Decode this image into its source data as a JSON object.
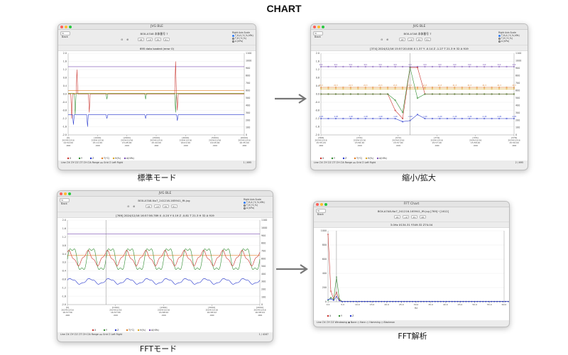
{
  "page_title": "CHART",
  "windows": [
    {
      "id": "w1",
      "window_title": "JVG BLE",
      "back_label": "< Back",
      "file_name": "BOX-A7A8 本体番号 7",
      "info_line": "695 data loaded (error 0)",
      "caption": "標準モード",
      "right_axis_scale": {
        "title": "Right Axis Scale",
        "options": [
          "T,H,A (℃,%,hPa)",
          "T,H (℃,%)",
          "A (hPa)"
        ],
        "selected": 0
      },
      "y_left": [
        "2.0",
        "1.6",
        "1.2",
        "0.8",
        "0.4",
        "0.0",
        "-0.4",
        "-0.8",
        "-1.2",
        "-1.6",
        "-2.0"
      ],
      "y_right": [
        "1100",
        "1000",
        "900",
        "800",
        "700",
        "600",
        "500",
        "400",
        "300",
        "200",
        "100",
        "0"
      ],
      "x_ticks": [
        [
          "[0]",
          "2024/12/16",
          "14:54:00",
          ".000"
        ],
        [
          "[1000]",
          "2024/12/16",
          "15:11:00",
          ".000"
        ],
        [
          "[2000]",
          "2024/12/16",
          "15:28:00",
          ".000"
        ],
        [
          "[3000]",
          "2024/12/16",
          "15:44:00",
          ".000"
        ],
        [
          "[4000]",
          "2024/12/16",
          "16:01:00",
          ".000"
        ],
        [
          "[5000]",
          "2024/12/16",
          "16:18:00",
          ".000"
        ],
        [
          "[6000]",
          "2024/12/16",
          "16:35:00",
          ".000"
        ]
      ],
      "legend": [
        "X",
        "Y",
        "Z",
        "T(℃)",
        "H(%)",
        "A(hPa)"
      ],
      "bottom_bar": "Line ☑X ☑Y ☑Z ☑T ☑H ☑A   Range ◂ ▸   Grid ☑ Left   Right",
      "page_range": "1 / 695"
    },
    {
      "id": "w2",
      "window_title": "JVG BLE",
      "back_label": "< Back",
      "file_name": "BOX-A7A8 本体番号 7",
      "info_line": "[374] 2024/12/16 15:57:20.000 X 1.37 Y -0.14 Z -1.27 T 21.3 H 32 A 919",
      "caption": "縮小/拡大",
      "right_axis_scale": {
        "title": "Right Axis Scale",
        "options": [
          "T,H,A (℃,%,hPa)",
          "T,H (℃,%)",
          "A (hPa)"
        ],
        "selected": 0
      },
      "y_left": [
        "2.0",
        "1.6",
        "1.2",
        "0.8",
        "0.4",
        "0.0",
        "-0.4",
        "-0.8",
        "-1.2",
        "-1.6",
        "-2.0"
      ],
      "y_right": [
        "1100",
        "1000",
        "900",
        "800",
        "700",
        "600",
        "500",
        "400",
        "300",
        "200",
        "100",
        "0"
      ],
      "x_ticks": [
        [
          "[368]",
          "2024/12/16",
          "15:55:20",
          ".000"
        ],
        [
          "[370]",
          "2024/12/16",
          "15:56:20",
          ".000"
        ],
        [
          "[372]",
          "2024/12/16",
          "15:57:00",
          ".000"
        ],
        [
          "[374]",
          "2024/12/16",
          "15:57:40",
          ".000"
        ],
        [
          "[376]",
          "2024/12/16",
          "15:58:20",
          ".000"
        ],
        [
          "[378]",
          "2024/12/16",
          "15:59:00",
          ".000"
        ]
      ],
      "point_labels": {
        "pressure": "919",
        "temp": "21.3",
        "humidity": "32",
        "x": "0.00",
        "z": "-1.20"
      },
      "legend": [
        "X",
        "Y",
        "Z",
        "T(℃)",
        "H(%)",
        "A(hPa)"
      ],
      "bottom_bar": "Line ☑X ☑Y ☑Z ☑T ☑H ☑A   Range ◂ ▸   Grid ☑ Left   Right",
      "page_range": "2 / 695"
    },
    {
      "id": "w3",
      "window_title": "JVG BLE",
      "back_label": "< Back",
      "file_name": "BOX-A7A8-No7_241216-165941_fft.jvg",
      "info_line": "[769] 2024/12/16 16:57:56.789 X -0.20 Y 0.19 Z -0.81 T 21.3 H 32 A 919",
      "caption": "FFTモード",
      "right_axis_scale": {
        "title": "Right Axis Scale",
        "options": [
          "T,H,A (℃,%,hPa)",
          "T,H (℃,%)",
          "A (hPa)"
        ],
        "selected": 0
      },
      "y_left": [
        "2.0",
        "1.6",
        "1.2",
        "0.8",
        "0.4",
        "0.0",
        "-0.4",
        "-0.8",
        "-1.2",
        "-1.6",
        "-2.0"
      ],
      "y_right": [
        "1100",
        "1000",
        "900",
        "800",
        "700",
        "600",
        "500",
        "400",
        "300",
        "200",
        "100",
        "0"
      ],
      "x_ticks": [
        [
          "[0]",
          "2024/12/16",
          "16:57:56",
          ".000"
        ],
        [
          "[1000]",
          "2024/12/16",
          "16:57:58",
          ".000"
        ],
        [
          "[2000]",
          "2024/12/16",
          "16:58:00",
          ".000"
        ],
        [
          "[3000]",
          "2024/12/16",
          "16:58:02",
          ".000"
        ],
        [
          "[4000]",
          "2024/12/16",
          "16:58:04",
          ".000"
        ]
      ],
      "legend": [
        "X",
        "Y",
        "Z",
        "T(℃)",
        "H(%)",
        "A(hPa)"
      ],
      "bottom_bar": "Line ☑X ☑Y ☑Z ☑T ☑H ☑A   Range ◂ ▸   Grid ☑ Left   Right",
      "page_range": "1 / 4167"
    },
    {
      "id": "w4",
      "window_title": "FFT Chart",
      "back_label": "< Back",
      "file_name": "BOX-A7A8-No7_241216-165941_fft.jvg [769]~[1612]",
      "info_line": "3.0Hz X134.31 Y349.32 Z74.04",
      "caption": "FFT解析",
      "y_left": [
        "1000",
        "800",
        "600",
        "400",
        "200",
        "0"
      ],
      "x_ticks": [
        "0.0",
        "5.0",
        "10.0",
        "15.0",
        "20.0",
        "25.0",
        "30.0",
        "35.0",
        "40.0",
        "45.0",
        "50.0",
        "55.0",
        "60.0"
      ],
      "x_unit": "Hz",
      "legend": [
        "X",
        "Y",
        "Z"
      ],
      "bottom_bar": "Line ☑X ☑Y ☑Z   Windowing ◉ None ○ Hann ○ Hamming ○ Blackman"
    }
  ],
  "toolbar_buttons": [
    "x2",
    "÷2",
    "2x",
    "2÷",
    "2X"
  ],
  "colors": {
    "x": "#c8302a",
    "y": "#2e8b2e",
    "z": "#2233cc",
    "temp": "#e07a1f",
    "humidity": "#d9a421",
    "pressure": "#7a4fb5",
    "accent": "#2e7cf6"
  }
}
